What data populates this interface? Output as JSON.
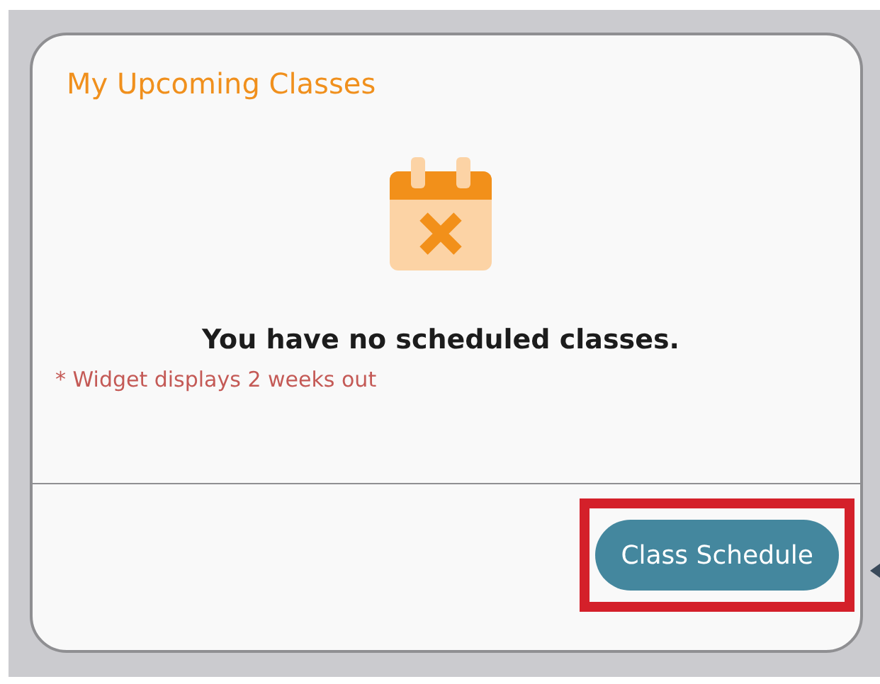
{
  "widget": {
    "title": "My Upcoming Classes",
    "empty_message": "You have no scheduled classes.",
    "note": "* Widget displays 2 weeks out",
    "button": {
      "label": "Class Schedule",
      "highlighted": true
    }
  }
}
